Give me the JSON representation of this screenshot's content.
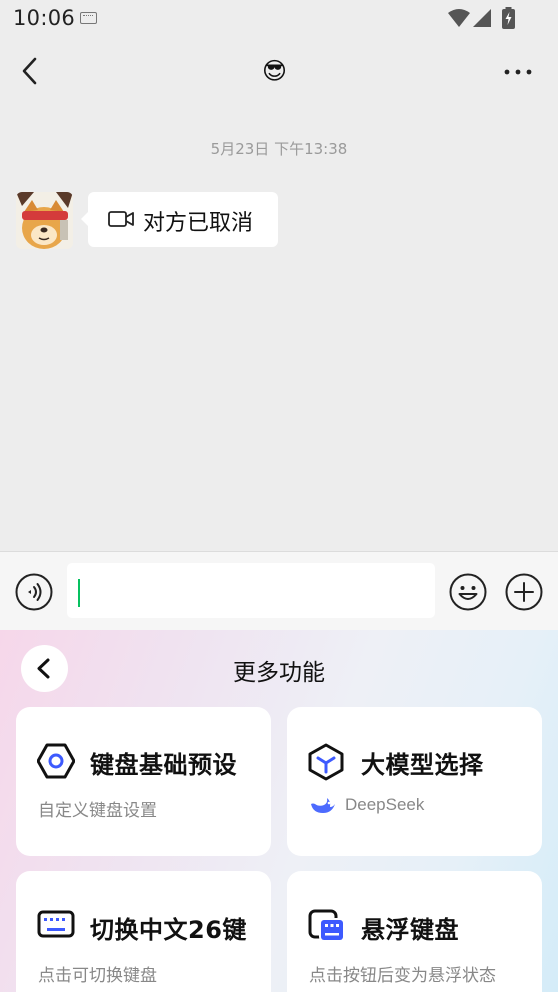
{
  "status_bar": {
    "time": "10:06"
  },
  "nav": {
    "title": "😎"
  },
  "chat": {
    "timestamp": "5月23日 下午13:38",
    "message": "对方已取消"
  },
  "input": {
    "placeholder": "",
    "value": ""
  },
  "panel": {
    "title": "更多功能",
    "cards": [
      {
        "title": "键盘基础预设",
        "subtitle": "自定义键盘设置",
        "icon": "hexagon-settings-icon"
      },
      {
        "title": "大模型选择",
        "subtitle": "DeepSeek",
        "icon": "cube-icon"
      },
      {
        "title": "切换中文26键",
        "subtitle": "点击可切换键盘",
        "icon": "keyboard-icon"
      },
      {
        "title": "悬浮键盘",
        "subtitle": "点击按钮后变为悬浮状态",
        "icon": "floating-keyboard-icon"
      }
    ]
  },
  "colors": {
    "accent": "#07c160",
    "icon_blue": "#3d5afe",
    "background": "#ededed"
  }
}
